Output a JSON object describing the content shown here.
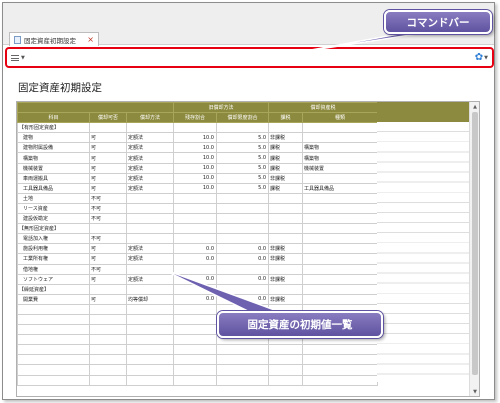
{
  "tab": {
    "title": "固定資産初期設定",
    "close": "×"
  },
  "callouts": {
    "command_bar": "コマンドバー",
    "initial_list": "固定資産の初期値一覧"
  },
  "page": {
    "title": "固定資産初期設定"
  },
  "grid": {
    "group_headers": {
      "old_method": "旧償却方法",
      "tax": "償却資産税"
    },
    "headers": [
      "科目",
      "償却可否",
      "償却方法",
      "残存割合",
      "償却限度割合",
      "課税",
      "種類"
    ],
    "rows": [
      {
        "section": true,
        "cells": [
          "【有形固定資産】",
          "",
          "",
          "",
          "",
          "",
          ""
        ]
      },
      {
        "cells": [
          "建物",
          "可",
          "定額法",
          "10.0",
          "5.0",
          "非課税",
          ""
        ]
      },
      {
        "cells": [
          "建物附属設備",
          "可",
          "定額法",
          "10.0",
          "5.0",
          "課税",
          "構築物"
        ]
      },
      {
        "cells": [
          "構築物",
          "可",
          "定額法",
          "10.0",
          "5.0",
          "課税",
          "構築物"
        ]
      },
      {
        "cells": [
          "機械装置",
          "可",
          "定額法",
          "10.0",
          "5.0",
          "課税",
          "機械装置"
        ]
      },
      {
        "cells": [
          "車両運搬具",
          "可",
          "定額法",
          "10.0",
          "5.0",
          "非課税",
          ""
        ]
      },
      {
        "cells": [
          "工具器具備品",
          "可",
          "定額法",
          "10.0",
          "5.0",
          "課税",
          "工具器具備品"
        ]
      },
      {
        "cells": [
          "土地",
          "不可",
          "",
          "",
          "",
          "",
          ""
        ]
      },
      {
        "cells": [
          "リース資産",
          "不可",
          "",
          "",
          "",
          "",
          ""
        ]
      },
      {
        "cells": [
          "建設仮勘定",
          "不可",
          "",
          "",
          "",
          "",
          ""
        ]
      },
      {
        "section": true,
        "cells": [
          "【無形固定資産】",
          "",
          "",
          "",
          "",
          "",
          ""
        ]
      },
      {
        "cells": [
          "電話加入権",
          "不可",
          "",
          "",
          "",
          "",
          ""
        ]
      },
      {
        "cells": [
          "施設利用権",
          "可",
          "定額法",
          "0.0",
          "0.0",
          "非課税",
          ""
        ]
      },
      {
        "cells": [
          "工業所有権",
          "可",
          "定額法",
          "0.0",
          "0.0",
          "非課税",
          ""
        ]
      },
      {
        "cells": [
          "借地権",
          "不可",
          "",
          "",
          "",
          "",
          ""
        ]
      },
      {
        "cells": [
          "ソフトウェア",
          "可",
          "定額法",
          "0.0",
          "0.0",
          "非課税",
          ""
        ]
      },
      {
        "section": true,
        "cells": [
          "【繰延資産】",
          "",
          "",
          "",
          "",
          "",
          ""
        ]
      },
      {
        "cells": [
          "開業費",
          "可",
          "均等償却",
          "0.0",
          "0.0",
          "非課税",
          ""
        ]
      },
      {
        "cells": [
          "",
          "",
          "",
          "",
          "",
          "",
          ""
        ]
      },
      {
        "cells": [
          "",
          "",
          "",
          "",
          "",
          "",
          ""
        ]
      },
      {
        "cells": [
          "",
          "",
          "",
          "",
          "",
          "",
          ""
        ]
      },
      {
        "cells": [
          "",
          "",
          "",
          "",
          "",
          "",
          ""
        ]
      },
      {
        "cells": [
          "",
          "",
          "",
          "",
          "",
          "",
          ""
        ]
      },
      {
        "cells": [
          "",
          "",
          "",
          "",
          "",
          "",
          ""
        ]
      },
      {
        "cells": [
          "",
          "",
          "",
          "",
          "",
          "",
          ""
        ]
      },
      {
        "cells": [
          "",
          "",
          "",
          "",
          "",
          "",
          ""
        ]
      }
    ]
  },
  "colors": {
    "highlight_border": "#e60012",
    "header_bg": "#8c8a3e",
    "callout_bg": "#6e61b0",
    "selected_cell": "#f0a000"
  },
  "icons": {
    "menu": "hamburger-icon",
    "settings": "gear-icon",
    "scroll_up": "chevron-up-icon",
    "scroll_down": "chevron-down-icon"
  }
}
